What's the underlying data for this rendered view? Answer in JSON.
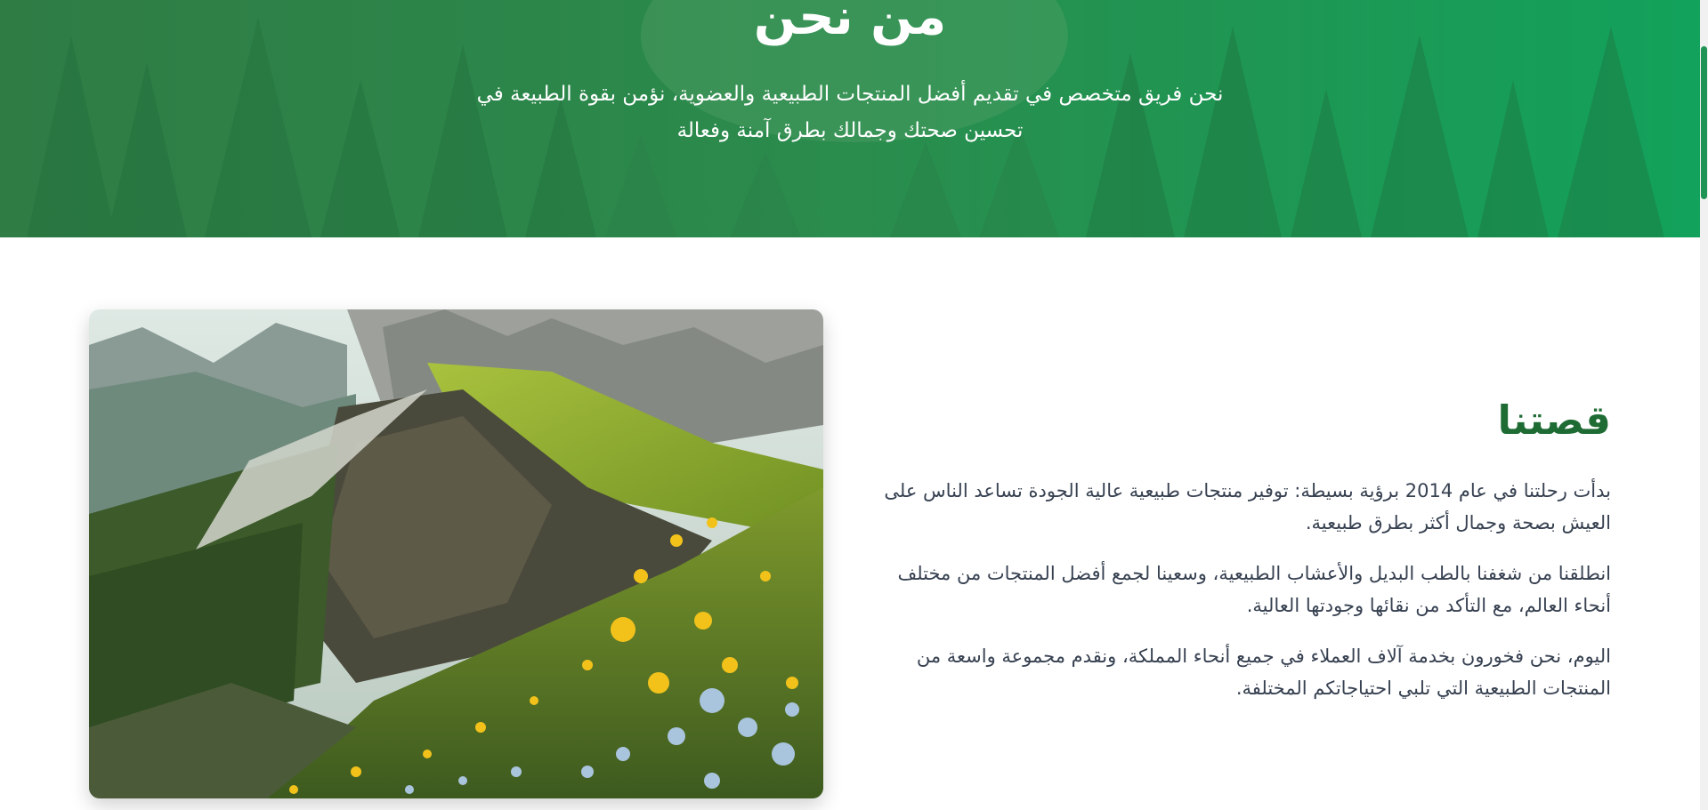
{
  "hero": {
    "title": "من نحن",
    "subtitle": "نحن فريق متخصص في تقديم أفضل المنتجات الطبيعية والعضوية، نؤمن بقوة الطبيعة في تحسين صحتك وجمالك بطرق آمنة وفعالة"
  },
  "story": {
    "title": "قصتنا",
    "paragraphs": [
      "بدأت رحلتنا في عام 2014 برؤية بسيطة: توفير منتجات طبيعية عالية الجودة تساعد الناس على العيش بصحة وجمال أكثر بطرق طبيعية.",
      "انطلقنا من شغفنا بالطب البديل والأعشاب الطبيعية، وسعينا لجمع أفضل المنتجات من مختلف أنحاء العالم، مع التأكد من نقائها وجودتها العالية.",
      "اليوم، نحن فخورون بخدمة آلاف العملاء في جميع أنحاء المملكة، ونقدم مجموعة واسعة من المنتجات الطبيعية التي تلبي احتياجاتكم المختلفة."
    ]
  },
  "colors": {
    "primary_green": "#1f9455",
    "heading_green": "#1e6b34",
    "body_text": "#374151"
  }
}
